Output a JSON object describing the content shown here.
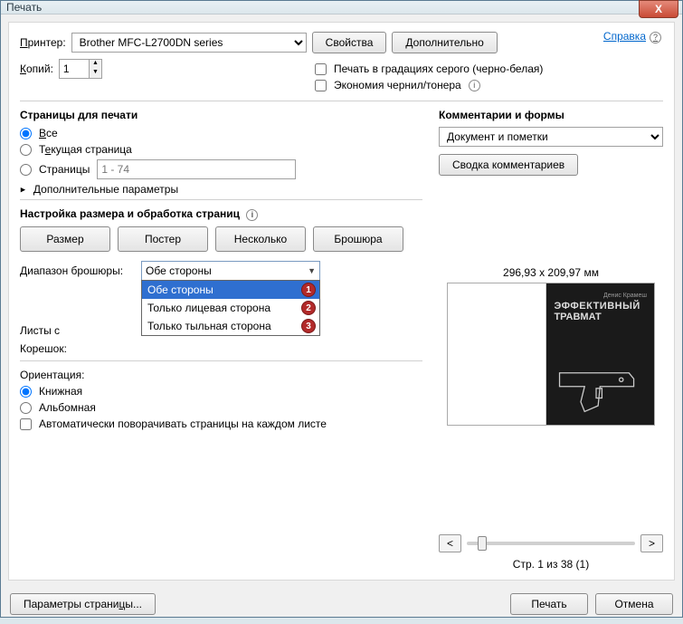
{
  "window": {
    "title": "Печать",
    "close_icon": "X"
  },
  "help": {
    "label": "Справка"
  },
  "printer": {
    "label": "Принтер:",
    "value": "Brother MFC-L2700DN series",
    "properties_btn": "Свойства",
    "advanced_btn": "Дополнительно"
  },
  "copies": {
    "label": "Копий:",
    "value": "1"
  },
  "options": {
    "grayscale": "Печать в градациях серого (черно-белая)",
    "save_ink": "Экономия чернил/тонера"
  },
  "pages_section": {
    "title": "Страницы для печати",
    "all": "Все",
    "current": "Текущая страница",
    "range_label": "Страницы",
    "range_placeholder": "1 - 74",
    "more": "Дополнительные параметры"
  },
  "sizing_section": {
    "title": "Настройка размера и обработка страниц",
    "size_btn": "Размер",
    "poster_btn": "Постер",
    "multiple_btn": "Несколько",
    "booklet_btn": "Брошюра"
  },
  "booklet": {
    "range_label": "Диапазон брошюры:",
    "selected": "Обе стороны",
    "opts": [
      "Обе стороны",
      "Только лицевая сторона",
      "Только тыльная сторона"
    ],
    "sheets_label": "Листы с",
    "spine_label": "Корешок:"
  },
  "orientation": {
    "title": "Ориентация:",
    "portrait": "Книжная",
    "landscape": "Альбомная",
    "auto_rotate": "Автоматически поворачивать страницы на каждом листе"
  },
  "comments": {
    "title": "Комментарии и формы",
    "select_value": "Документ и пометки",
    "summary_btn": "Сводка комментариев"
  },
  "preview": {
    "dims": "296,93 x 209,97 мм",
    "doc_title1": "ЭФФЕКТИВНЫЙ",
    "doc_title2": "ТРАВМАТ",
    "page_indicator": "Стр. 1 из 38 (1)"
  },
  "footer": {
    "page_setup": "Параметры страницы...",
    "print": "Печать",
    "cancel": "Отмена"
  }
}
